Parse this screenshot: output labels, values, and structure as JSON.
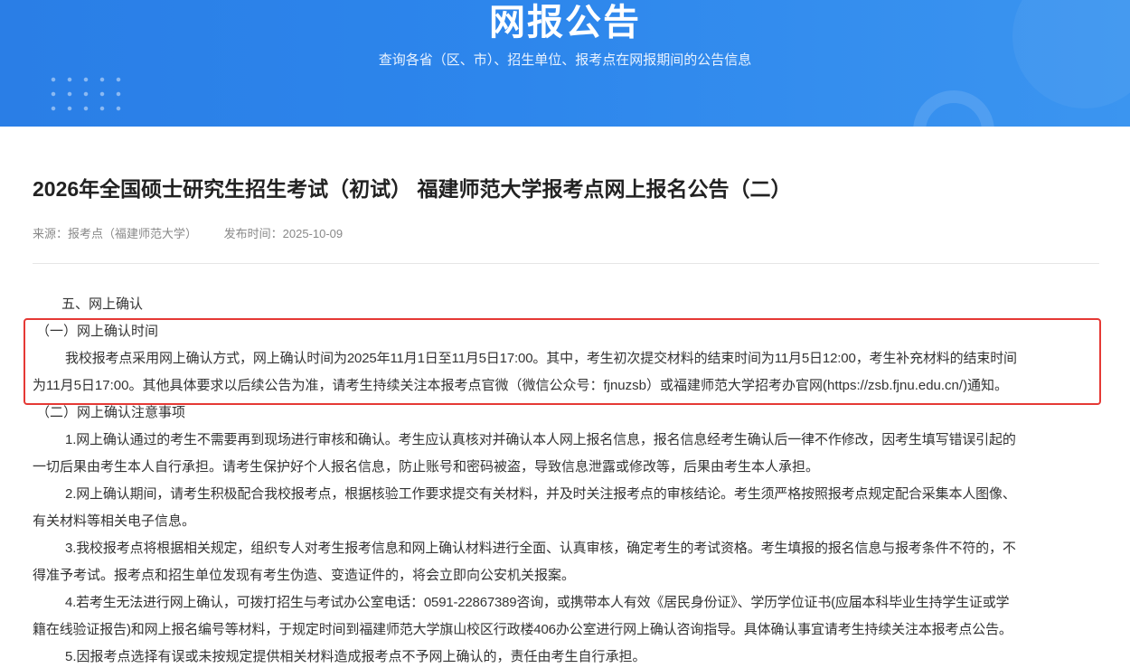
{
  "banner": {
    "title": "网报公告",
    "subtitle": "查询各省（区、市）、招生单位、报考点在网报期间的公告信息"
  },
  "article": {
    "title": "2026年全国硕士研究生招生考试（初试） 福建师范大学报考点网上报名公告（二）",
    "source": "来源：报考点（福建师范大学）",
    "publish_time": "发布时间：2025-10-09",
    "section_heading": "五、网上确认",
    "sub1_heading": "（一）网上确认时间",
    "sub1_line1": "我校报考点采用网上确认方式，网上确认时间为2025年11月1日至11月5日17:00。其中，考生初次提交材料的结束时间为11月5日12:00，考生补充材料的结束时间",
    "sub1_line2": "为11月5日17:00。其他具体要求以后续公告为准，请考生持续关注本报考点官微（微信公众号：fjnuzsb）或福建师范大学招考办官网(https://zsb.fjnu.edu.cn/)通知。",
    "sub2_heading": "（二）网上确认注意事项",
    "item1_line1": "1.网上确认通过的考生不需要再到现场进行审核和确认。考生应认真核对并确认本人网上报名信息，报名信息经考生确认后一律不作修改，因考生填写错误引起的",
    "item1_line2": "一切后果由考生本人自行承担。请考生保护好个人报名信息，防止账号和密码被盗，导致信息泄露或修改等，后果由考生本人承担。",
    "item2_line1": "2.网上确认期间，请考生积极配合我校报考点，根据核验工作要求提交有关材料，并及时关注报考点的审核结论。考生须严格按照报考点规定配合采集本人图像、",
    "item2_line2": "有关材料等相关电子信息。",
    "item3_line1": "3.我校报考点将根据相关规定，组织专人对考生报考信息和网上确认材料进行全面、认真审核，确定考生的考试资格。考生填报的报名信息与报考条件不符的，不",
    "item3_line2": "得准予考试。报考点和招生单位发现有考生伪造、变造证件的，将会立即向公安机关报案。",
    "item4_line1": "4.若考生无法进行网上确认，可拨打招生与考试办公室电话：0591-22867389咨询，或携带本人有效《居民身份证》、学历学位证书(应届本科毕业生持学生证或学",
    "item4_line2": "籍在线验证报告)和网上报名编号等材料，于规定时间到福建师范大学旗山校区行政楼406办公室进行网上确认咨询指导。具体确认事宜请考生持续关注本报考点公告。",
    "item5_line1": "5.因报考点选择有误或未按规定提供相关材料造成报考点不予网上确认的，责任由考生自行承担。"
  },
  "colors": {
    "banner_blue": "#2d86ec",
    "highlight_red": "#e53935"
  }
}
